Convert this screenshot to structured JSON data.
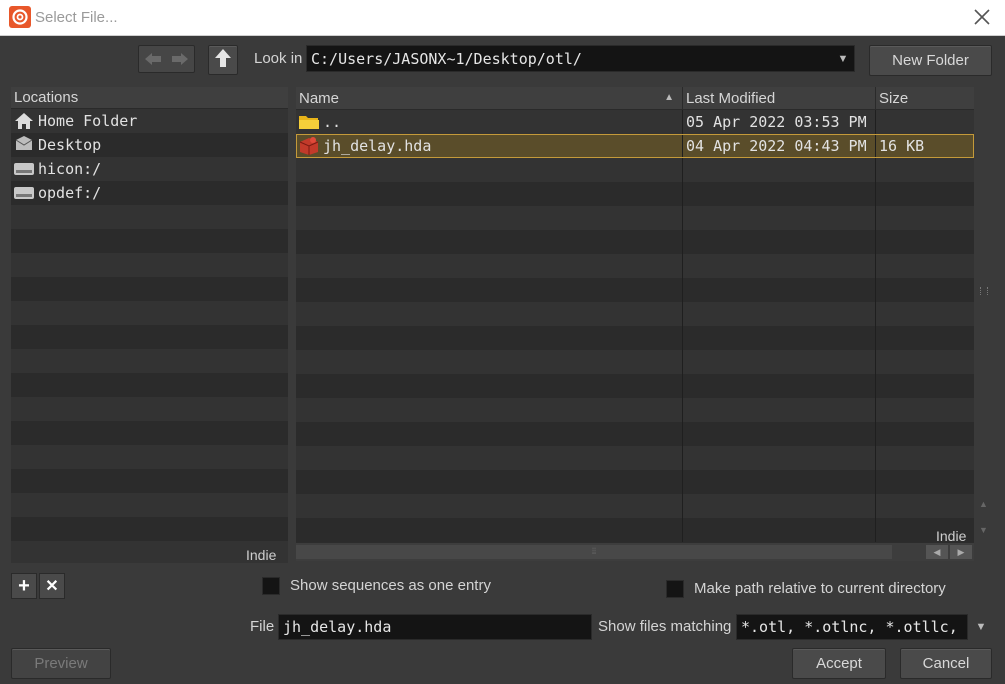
{
  "window": {
    "title": "Select File..."
  },
  "toolbar": {
    "look_in_label": "Look in",
    "path_value": "C:/Users/JASONX~1/Desktop/otl/",
    "new_folder_label": "New Folder"
  },
  "locations": {
    "header": "Locations",
    "items": [
      {
        "label": "Home Folder",
        "icon": "home-icon"
      },
      {
        "label": "Desktop",
        "icon": "desktop-icon"
      },
      {
        "label": "hicon:/",
        "icon": "drive-icon"
      },
      {
        "label": "opdef:/",
        "icon": "drive-icon"
      }
    ],
    "watermark": "Indie"
  },
  "files": {
    "columns": {
      "name": "Name",
      "modified": "Last Modified",
      "size": "Size"
    },
    "rows": [
      {
        "name": "..",
        "modified": "05 Apr 2022 03:53 PM",
        "size": "",
        "icon": "folder-icon"
      },
      {
        "name": "jh_delay.hda",
        "modified": "04 Apr 2022 04:43 PM",
        "size": "16 KB",
        "icon": "hda-package-icon",
        "selected": true
      }
    ],
    "watermark": "Indie"
  },
  "options": {
    "show_sequences_label": "Show sequences as one entry",
    "relative_path_label": "Make path relative to current directory"
  },
  "file_field": {
    "label": "File",
    "value": "jh_delay.hda"
  },
  "filter": {
    "label": "Show files matching",
    "value": "*.otl, *.otlnc, *.otllc, "
  },
  "buttons": {
    "preview": "Preview",
    "accept": "Accept",
    "cancel": "Cancel"
  },
  "colors": {
    "background": "#3a3a3a",
    "selection": "#5a4d2a",
    "selection_border": "#c49a3a",
    "brand": "#e8572a"
  }
}
